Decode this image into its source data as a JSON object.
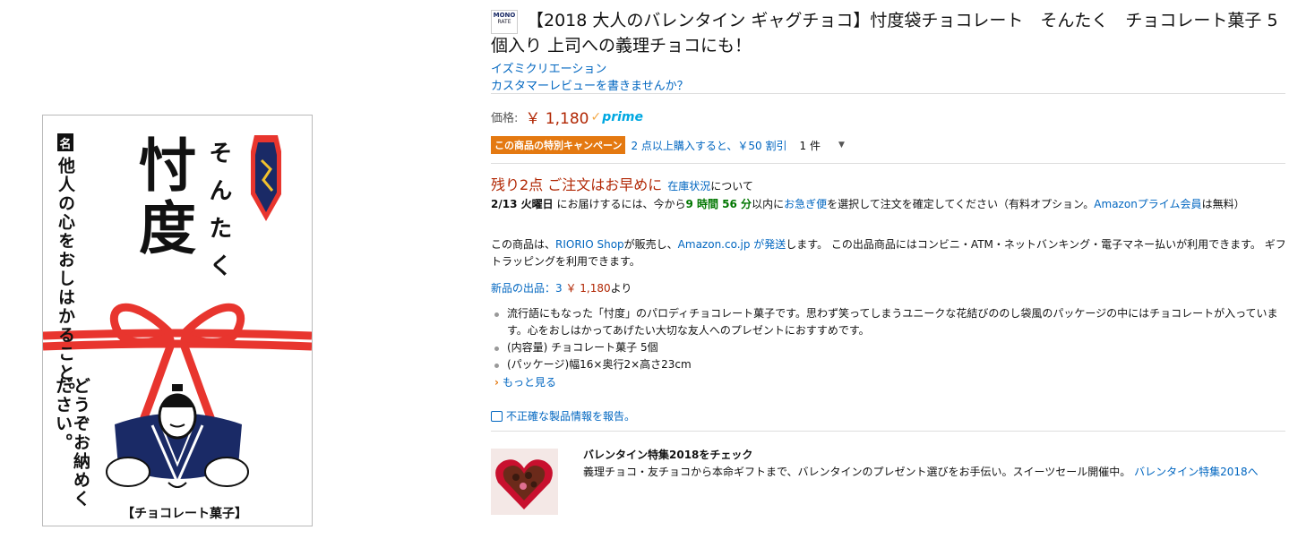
{
  "product_image": {
    "name_mark": "名",
    "meaning": "他人の心をおしはかること。",
    "big_kanji": "忖度",
    "reading": "そんたく",
    "closing": "どうぞお納めください。",
    "bottom_label": "【チョコレート菓子】"
  },
  "brand_logo": {
    "line1": "MONO",
    "line2": "RATE"
  },
  "title": "【2018 大人のバレンタイン ギャグチョコ】忖度袋チョコレート　そんたく　チョコレート菓子 5個入り 上司への義理チョコにも！",
  "brand_link": "イズミクリエーション",
  "review_link": "カスタマーレビューを書きませんか？",
  "price": {
    "label": "価格:",
    "value": "￥ 1,180",
    "prime": "prime"
  },
  "promo": {
    "badge": "この商品の特別キャンペーン",
    "text": "2 点以上購入すると、￥50 割引",
    "qty": "1 件"
  },
  "stock": {
    "alert": "残り2点 ご注文はお早めに",
    "link": "在庫状況",
    "suffix": "について"
  },
  "delivery": {
    "date": "2/13 火曜日",
    "t1": "にお届けするには、今から",
    "countdown": "9 時間 56 分",
    "t2": "以内に",
    "link1": "お急ぎ便",
    "t3": "を選択して注文を確定してください（有料オプション。",
    "link2": "Amazonプライム会員",
    "t4": "は無料）"
  },
  "seller": {
    "t1": "この商品は、",
    "link1": "RIORIO Shop",
    "t2": "が販売し、",
    "link2": "Amazon.co.jp が発送",
    "t3": "します。 この出品商品にはコンビニ・ATM・ネットバンキング・電子マネー払いが利用できます。 ギフトラッピングを利用できます。"
  },
  "new_offers": {
    "label": "新品の出品：3",
    "price": "￥ 1,180",
    "suffix": "より"
  },
  "bullets": [
    "流行語にもなった「忖度」のパロディチョコレート菓子です。思わず笑ってしまうユニークな花結びののし袋風のパッケージの中にはチョコレートが入っています。心をおしはかってあげたい大切な友人へのプレゼントにおすすめです。",
    "(内容量) チョコレート菓子 5個",
    "(パッケージ)幅16×奥行2×高さ23cm"
  ],
  "more_link": "もっと見る",
  "report_link": "不正確な製品情報を報告。",
  "banner": {
    "title": "バレンタイン特集2018をチェック",
    "text": "義理チョコ・友チョコから本命ギフトまで、バレンタインのプレゼント選びをお手伝い。スイーツセール開催中。",
    "link": "バレンタイン特集2018へ"
  }
}
